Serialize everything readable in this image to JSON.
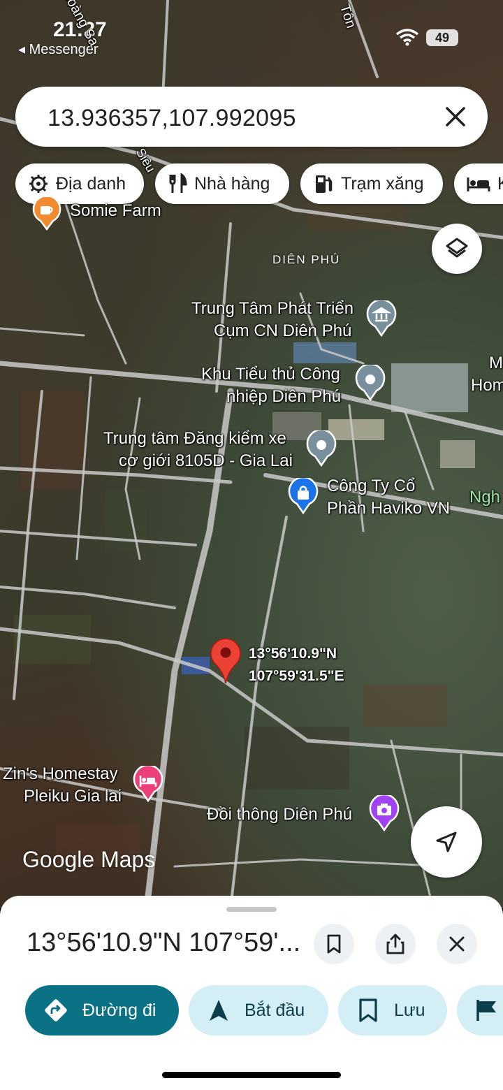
{
  "status_bar": {
    "time": "21:27",
    "back_app": "◂ Messenger",
    "battery": "49"
  },
  "search": {
    "query": "13.936357,107.992095"
  },
  "chips": [
    {
      "label": "Địa danh",
      "icon": "landmark-icon"
    },
    {
      "label": "Nhà hàng",
      "icon": "restaurant-icon"
    },
    {
      "label": "Trạm xăng",
      "icon": "gas-station-icon"
    },
    {
      "label": "K",
      "icon": "hotel-icon"
    }
  ],
  "map": {
    "street_labels": [
      "Hoàng Sa",
      "Tôn",
      "Siêu"
    ],
    "area_label": "DIÊN PHÚ",
    "places": [
      {
        "name": "Somie Farm",
        "lines": [
          "Somie Farm"
        ],
        "icon": "cafe-icon",
        "color": "#f28b30"
      },
      {
        "name": "Trung Tâm Phát Triển Cụm CN Diên Phú",
        "lines": [
          "Trung Tâm Phát Triển",
          "Cụm CN Diên Phú"
        ],
        "icon": "government-building-icon",
        "color": "#78909c"
      },
      {
        "name": "Khu Tiểu thủ Công nhiệp Diên Phú",
        "lines": [
          "Khu Tiểu thủ Công",
          "nhiệp Diên Phú"
        ],
        "icon": "place-pin-icon",
        "color": "#78909c"
      },
      {
        "name": "Trung tâm Đăng kiểm xe cơ giới 8105D - Gia Lai",
        "lines": [
          "Trung tâm Đăng kiểm xe",
          "cơ giới 8105D - Gia Lai"
        ],
        "icon": "place-pin-icon",
        "color": "#78909c"
      },
      {
        "name": "Công Ty Cổ Phần Haviko VN",
        "lines": [
          "Công Ty Cổ",
          "Phần Haviko VN"
        ],
        "icon": "shopping-bag-icon",
        "color": "#1a73e8"
      },
      {
        "name": "Zin's Homestay Pleiku Gia lai",
        "lines": [
          "Zin's Homestay",
          "Pleiku Gia lai"
        ],
        "icon": "bed-icon",
        "color": "#ec407a"
      },
      {
        "name": "Đồi thông Diên Phú",
        "lines": [
          "Đồi thông Diên Phú"
        ],
        "icon": "camera-icon",
        "color": "#a142f4"
      }
    ],
    "edge_labels": [
      "M",
      "Hom",
      "Ngh"
    ],
    "dropped_pin": {
      "lat": "13°56'10.9\"N",
      "lng": "107°59'31.5\"E"
    },
    "logo": "Google Maps"
  },
  "sheet": {
    "title": "13°56'10.9\"N 107°59'...",
    "actions": [
      {
        "label": "Đường đi",
        "icon": "directions-icon",
        "primary": true
      },
      {
        "label": "Bắt đầu",
        "icon": "navigation-arrow-icon",
        "primary": false
      },
      {
        "label": "Lưu",
        "icon": "bookmark-icon",
        "primary": false
      },
      {
        "label": "",
        "icon": "flag-icon",
        "primary": false
      }
    ]
  },
  "colors": {
    "accent": "#0b7285",
    "pin_red": "#ea4335",
    "chip_bg": "#ffffff",
    "action_bg": "#d3eef5"
  }
}
